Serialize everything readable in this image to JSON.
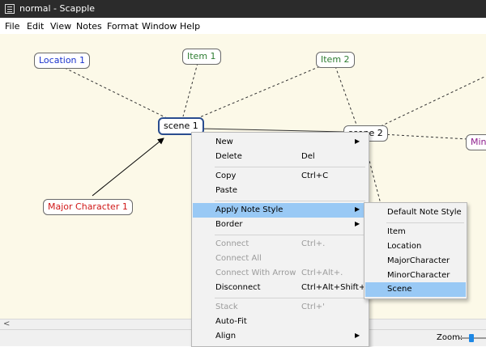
{
  "window": {
    "title": "normal - Scapple"
  },
  "menubar": [
    "File",
    "Edit",
    "View",
    "Notes",
    "Format",
    "Window",
    "Help"
  ],
  "notes": {
    "location1": {
      "text": "Location 1",
      "color": "#1a33cc"
    },
    "item1": {
      "text": "Item 1",
      "color": "#2e7d32"
    },
    "item2": {
      "text": "Item 2",
      "color": "#2e7d32"
    },
    "scene1": {
      "text": "scene 1",
      "color": "#000000"
    },
    "scene2": {
      "text": "scene 2",
      "color": "#000000"
    },
    "minor": {
      "text": "Minor",
      "color": "#8e1e8e"
    },
    "major1": {
      "text": "Major Character 1",
      "color": "#d01818"
    }
  },
  "context_menu": {
    "new": "New",
    "delete": "Delete",
    "delete_sc": "Del",
    "copy": "Copy",
    "copy_sc": "Ctrl+C",
    "paste": "Paste",
    "apply_note_style": "Apply Note Style",
    "border": "Border",
    "connect": "Connect",
    "connect_sc": "Ctrl+.",
    "connect_all": "Connect All",
    "connect_arrow": "Connect With Arrow",
    "connect_arrow_sc": "Ctrl+Alt+.",
    "disconnect": "Disconnect",
    "disconnect_sc": "Ctrl+Alt+Shift+.",
    "stack": "Stack",
    "stack_sc": "Ctrl+'",
    "autofit": "Auto-Fit",
    "align": "Align"
  },
  "submenu": {
    "default": "Default Note Style",
    "item": "Item",
    "location": "Location",
    "major": "MajorCharacter",
    "minor": "MinorCharacter",
    "scene": "Scene"
  },
  "status": {
    "zoom_label": "Zoom:"
  },
  "colors": {
    "canvas_bg": "#fcf9e8",
    "highlight": "#99c9f5",
    "titlebar": "#2b2b2b"
  }
}
